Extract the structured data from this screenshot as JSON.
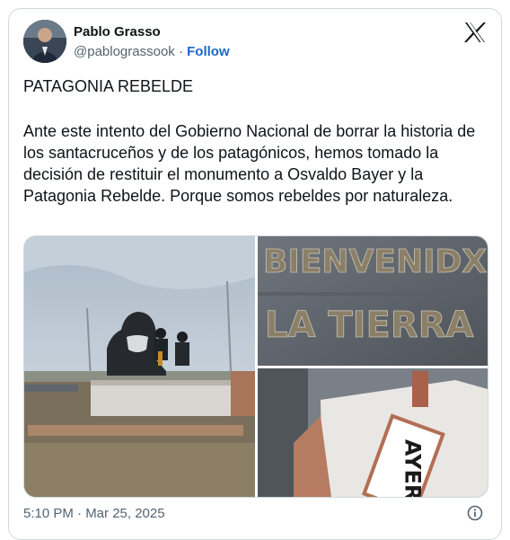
{
  "author": {
    "name": "Pablo Grasso",
    "handle": "@pablograssook",
    "separator": "·",
    "follow_label": "Follow"
  },
  "header": {
    "x_logo_icon": "x-logo-icon"
  },
  "post": {
    "title": "PATAGONIA REBELDE",
    "body": "Ante este intento del Gobierno Nacional de borrar la historia de los santacruceños y de los patagónicos, hemos tomado la decisión de restituir el monumento a Osvaldo Bayer y la Patagonia Rebelde. Porque somos rebeldes por naturaleza."
  },
  "media": {
    "photo2_text_line1": "BIENVENIDX",
    "photo2_text_line2": "LA TIERRA",
    "photo3_text": "AYER"
  },
  "footer": {
    "timestamp": "5:10 PM · Mar 25, 2025",
    "info_icon": "info-icon"
  }
}
